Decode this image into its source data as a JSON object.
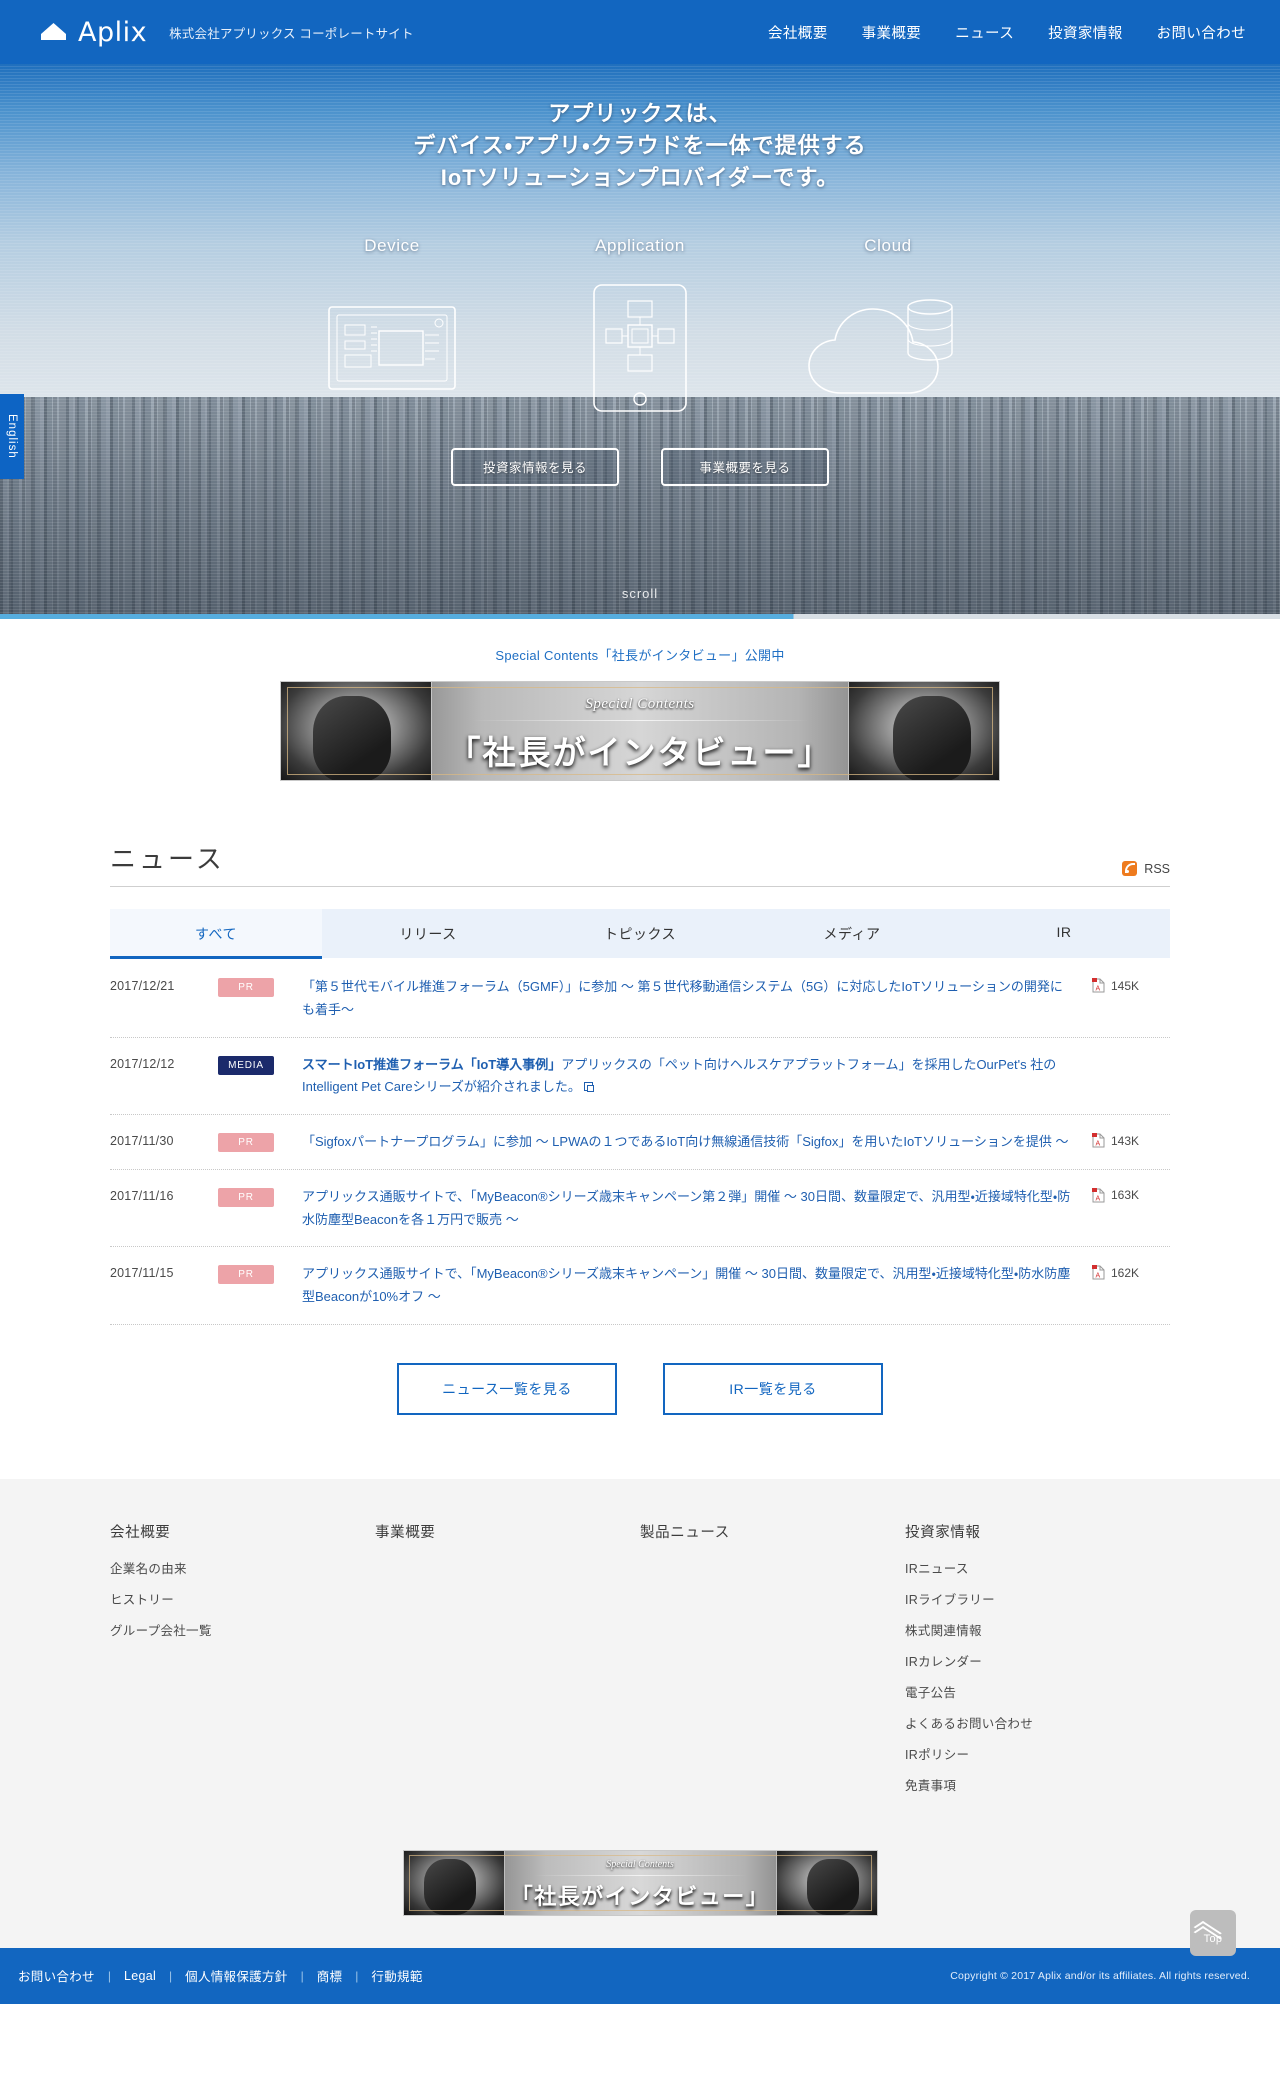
{
  "header": {
    "logo_text": "Aplix",
    "tagline": "株式会社アプリックス コーポレートサイト",
    "nav": [
      {
        "label": "会社概要"
      },
      {
        "label": "事業概要"
      },
      {
        "label": "ニュース"
      },
      {
        "label": "投資家情報"
      },
      {
        "label": "お問い合わせ"
      }
    ]
  },
  "hero": {
    "title_line1": "アプリックスは、",
    "title_line2": "デバイス・アプリ・クラウドを一体で提供する",
    "title_line3": "IoTソリューションプロバイダーです。",
    "columns": [
      {
        "label": "Device"
      },
      {
        "label": "Application"
      },
      {
        "label": "Cloud"
      }
    ],
    "buttons": [
      {
        "label": "投資家情報を見る"
      },
      {
        "label": "事業概要を見る"
      }
    ],
    "scroll_label": "scroll",
    "english_tab": "English"
  },
  "special": {
    "link_text": "Special Contents「社長がインタビュー」公開中",
    "banner_caption": "Special Contents",
    "banner_title": "「社長がインタビュー」"
  },
  "news": {
    "title": "ニュース",
    "rss_label": "RSS",
    "tabs": [
      {
        "label": "すべて",
        "active": true
      },
      {
        "label": "リリース",
        "active": false
      },
      {
        "label": "トピックス",
        "active": false
      },
      {
        "label": "メディア",
        "active": false
      },
      {
        "label": "IR",
        "active": false
      }
    ],
    "items": [
      {
        "date": "2017/12/21",
        "badge": "PR",
        "badge_type": "pr",
        "text": "「第５世代モバイル推進フォーラム（5GMF）」に参加 〜 第５世代移動通信システム（5G）に対応したIoTソリューションの開発にも着手〜",
        "bold_text": "",
        "size": "145K",
        "has_pdf": true,
        "has_external": false
      },
      {
        "date": "2017/12/12",
        "badge": "MEDIA",
        "badge_type": "media",
        "text": "アプリックスの「ペット向けヘルスケアプラットフォーム」を採用したOurPet's 社の Intelligent Pet Careシリーズが紹介されました。",
        "bold_text": "スマートIoT推進フォーラム「IoT導入事例」",
        "size": "",
        "has_pdf": false,
        "has_external": true
      },
      {
        "date": "2017/11/30",
        "badge": "PR",
        "badge_type": "pr",
        "text": "「Sigfoxパートナープログラム」に参加 〜 LPWAの１つであるIoT向け無線通信技術「Sigfox」を用いたIoTソリューションを提供 〜",
        "bold_text": "",
        "size": "143K",
        "has_pdf": true,
        "has_external": false
      },
      {
        "date": "2017/11/16",
        "badge": "PR",
        "badge_type": "pr",
        "text": "アプリックス通販サイトで、「MyBeacon®シリーズ歳末キャンペーン第２弾」開催 〜 30日間、数量限定で、汎用型・近接域特化型・防水防塵型Beaconを各１万円で販売 〜",
        "bold_text": "",
        "size": "163K",
        "has_pdf": true,
        "has_external": false
      },
      {
        "date": "2017/11/15",
        "badge": "PR",
        "badge_type": "pr",
        "text": "アプリックス通販サイトで、「MyBeacon®シリーズ歳末キャンペーン」開催 〜 30日間、数量限定で、汎用型・近接域特化型・防水防塵型Beaconが10%オフ 〜",
        "bold_text": "",
        "size": "162K",
        "has_pdf": true,
        "has_external": false
      }
    ],
    "actions": [
      {
        "label": "ニュース一覧を見る"
      },
      {
        "label": "IR一覧を見る"
      }
    ]
  },
  "footer": {
    "columns": [
      {
        "heading": "会社概要",
        "links": [
          {
            "label": "企業名の由来"
          },
          {
            "label": "ヒストリー"
          },
          {
            "label": "グループ会社一覧"
          }
        ]
      },
      {
        "heading": "事業概要",
        "links": []
      },
      {
        "heading": "製品ニュース",
        "links": []
      },
      {
        "heading": "投資家情報",
        "links": [
          {
            "label": "IRニュース"
          },
          {
            "label": "IRライブラリー"
          },
          {
            "label": "株式関連情報"
          },
          {
            "label": "IRカレンダー"
          },
          {
            "label": "電子公告"
          },
          {
            "label": "よくあるお問い合わせ"
          },
          {
            "label": "IRポリシー"
          },
          {
            "label": "免責事項"
          }
        ]
      }
    ],
    "top_button": "Top"
  },
  "bottom_bar": {
    "links": [
      {
        "label": "お問い合わせ"
      },
      {
        "label": "Legal"
      },
      {
        "label": "個人情報保護方針"
      },
      {
        "label": "商標"
      },
      {
        "label": "行動規範"
      }
    ],
    "separator": "|",
    "copyright": "Copyright © 2017 Aplix and/or its affiliates. All rights reserved."
  },
  "colors": {
    "brand_blue": "#1266c0",
    "link_blue": "#1f5fb0",
    "pr_badge": "#eda3a8",
    "media_badge": "#1b2a6b",
    "rss_orange": "#ee7b1e"
  }
}
